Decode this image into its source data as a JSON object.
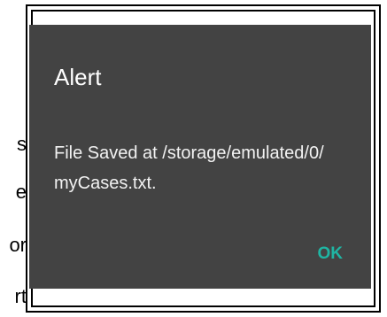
{
  "background_text": {
    "lines": [
      "s",
      "e",
      "or",
      "rt"
    ]
  },
  "dialog": {
    "title": "Alert",
    "message": "File Saved at /storage/emulated/0/ myCases.txt.",
    "ok_label": "OK"
  },
  "colors": {
    "dialog_background": "#434343",
    "title_text": "#ffffff",
    "message_text": "#f2f2f2",
    "ok_accent": "#1fb5a3"
  }
}
